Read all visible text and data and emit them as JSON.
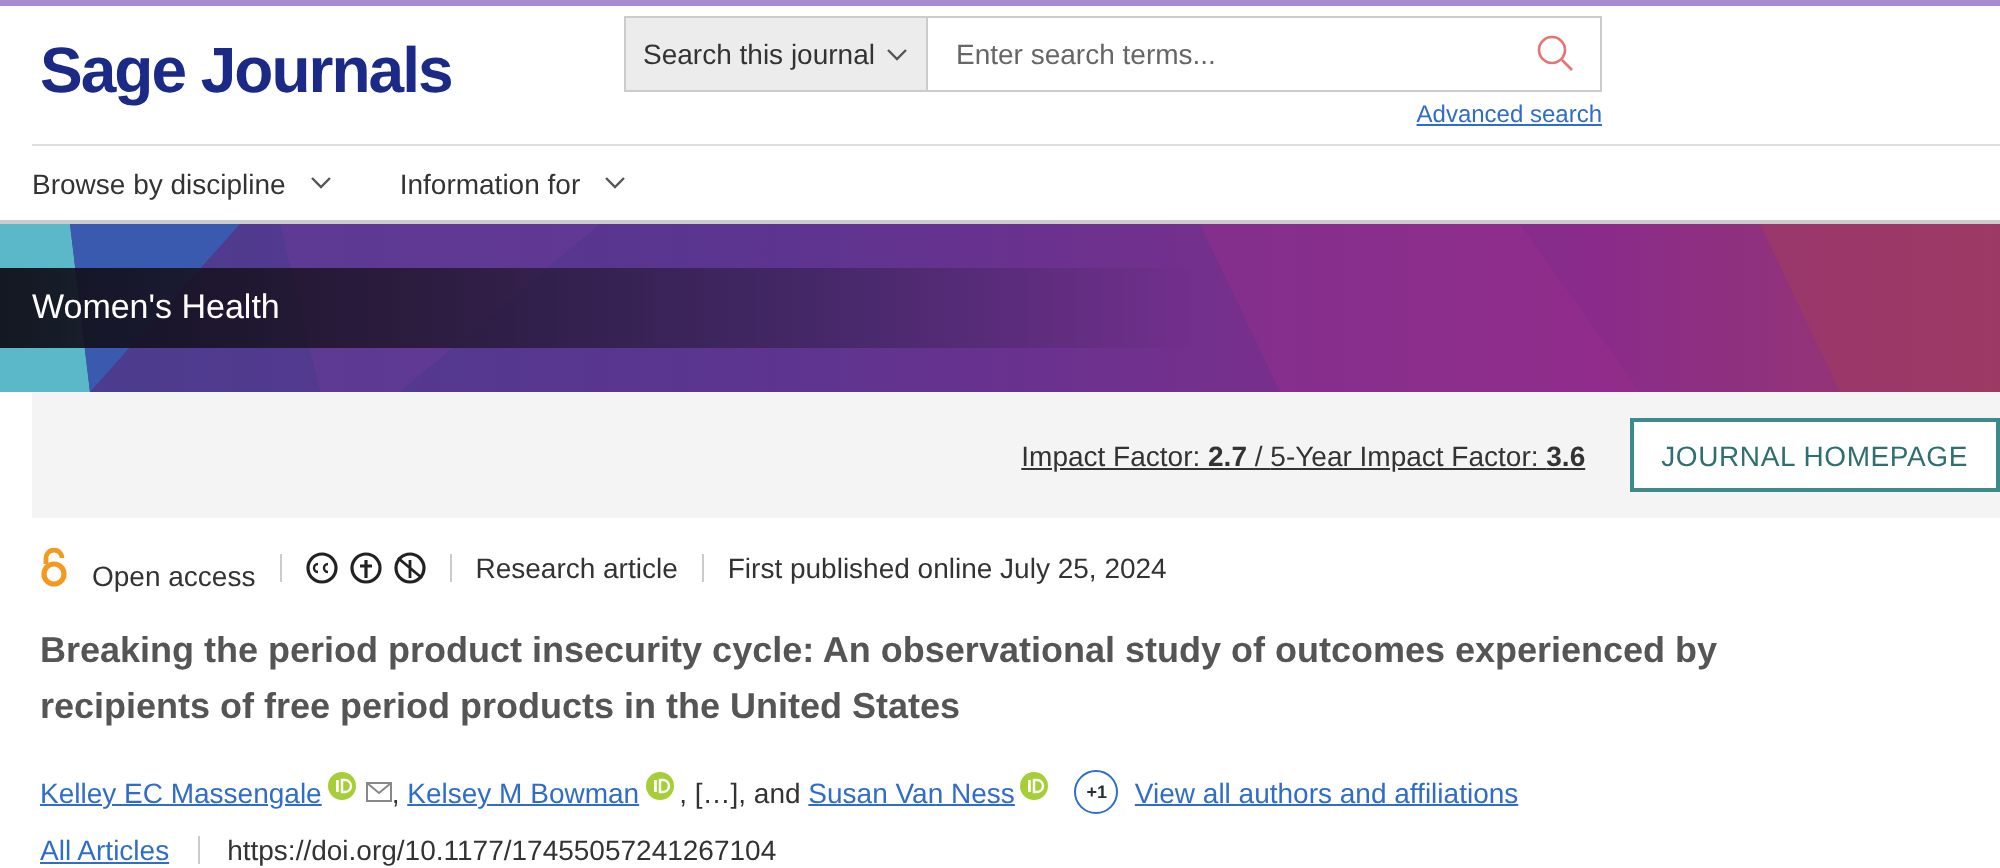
{
  "header": {
    "logo": "Sage Journals",
    "search_scope": "Search this journal",
    "search": {
      "placeholder": "Enter search terms..."
    },
    "advanced_link": "Advanced search"
  },
  "nav": [
    {
      "label": "Browse by discipline"
    },
    {
      "label": "Information for"
    }
  ],
  "banner": {
    "title": "Women's Health"
  },
  "metrics": {
    "impact_label": "Impact Factor: ",
    "impact_value": "2.7",
    "separator": " / ",
    "five_year_label": "5-Year Impact Factor: ",
    "five_year_value": "3.6",
    "button": "JOURNAL HOMEPAGE"
  },
  "meta": {
    "access": "Open access",
    "type": "Research article",
    "published": "First published online July 25, 2024"
  },
  "title": "Breaking the period product insecurity cycle: An observational study of outcomes experienced by recipients of free period products in the United States",
  "authors": [
    {
      "name": "Kelley EC Massengale",
      "orcid": true,
      "email": true,
      "after": ", "
    },
    {
      "name": "Kelsey M Bowman",
      "orcid": true,
      "after": ", […], and "
    },
    {
      "name": "Susan Van Ness",
      "orcid": true
    }
  ],
  "more_authors": "+1",
  "view_all": "View all authors and affiliations",
  "footer": {
    "link": "All Articles",
    "doi": "https://doi.org/10.1177/17455057241267104"
  }
}
